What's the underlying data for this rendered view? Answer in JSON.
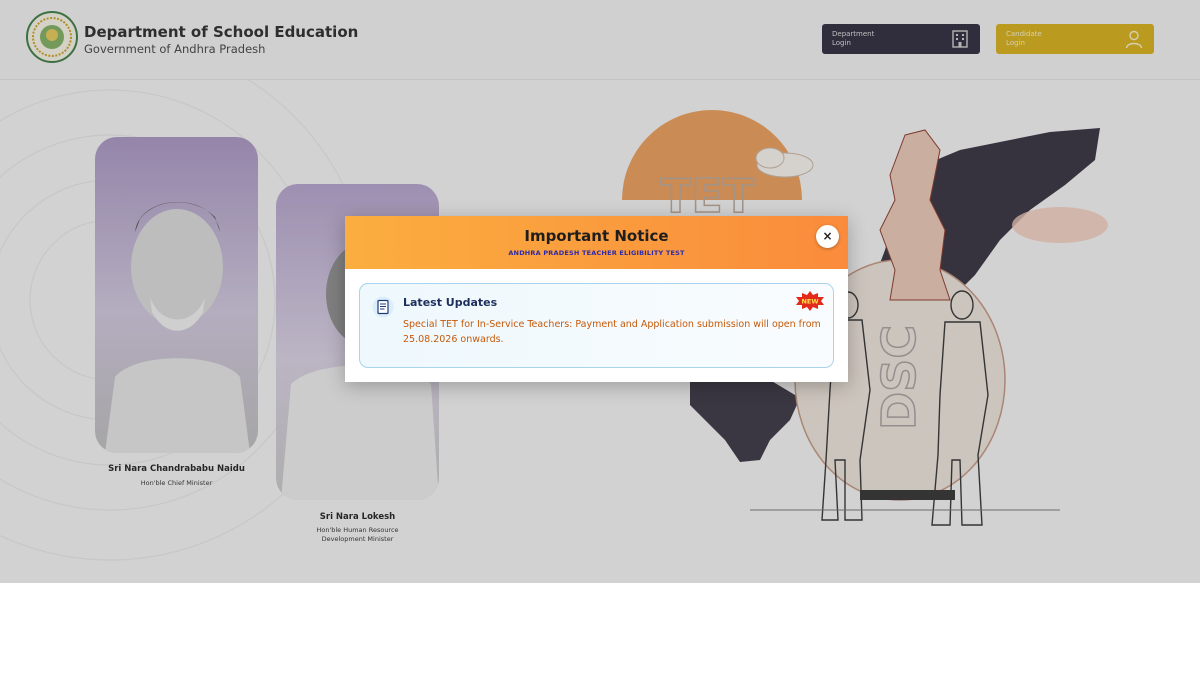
{
  "header": {
    "dept_title": "Department of School Education",
    "dept_subtitle": "Government of Andhra Pradesh",
    "department_login": {
      "line1": "Department",
      "line2": "Login",
      "icon": "building-icon"
    },
    "candidate_login": {
      "line1": "Candidate",
      "line2": "Login",
      "icon": "user-icon"
    }
  },
  "leaders": [
    {
      "name": "Sri Nara Chandrababu Naidu",
      "role": "Hon'ble Chief Minister"
    },
    {
      "name": "Sri Nara Lokesh",
      "role_line1": "Hon'ble Human Resource",
      "role_line2": "Development Minister"
    }
  ],
  "hero": {
    "tet_text": "TET",
    "dsc_text": "DSC"
  },
  "modal": {
    "title": "Important Notice",
    "subtitle": "ANDHRA PRADESH TEACHER ELIGIBILITY TEST",
    "close_label": "×",
    "update": {
      "title": "Latest Updates",
      "badge": "NEW",
      "text": "Special TET for In-Service Teachers: Payment and Application submission will open from 25.08.2026 onwards."
    }
  },
  "colors": {
    "modal_header_start": "#fbae3f",
    "modal_header_end": "#fa8b3c",
    "department_btn": "#2e2b3d",
    "candidate_btn": "#d6b01a",
    "update_text": "#c65a0a",
    "update_title": "#1e2e5c"
  }
}
